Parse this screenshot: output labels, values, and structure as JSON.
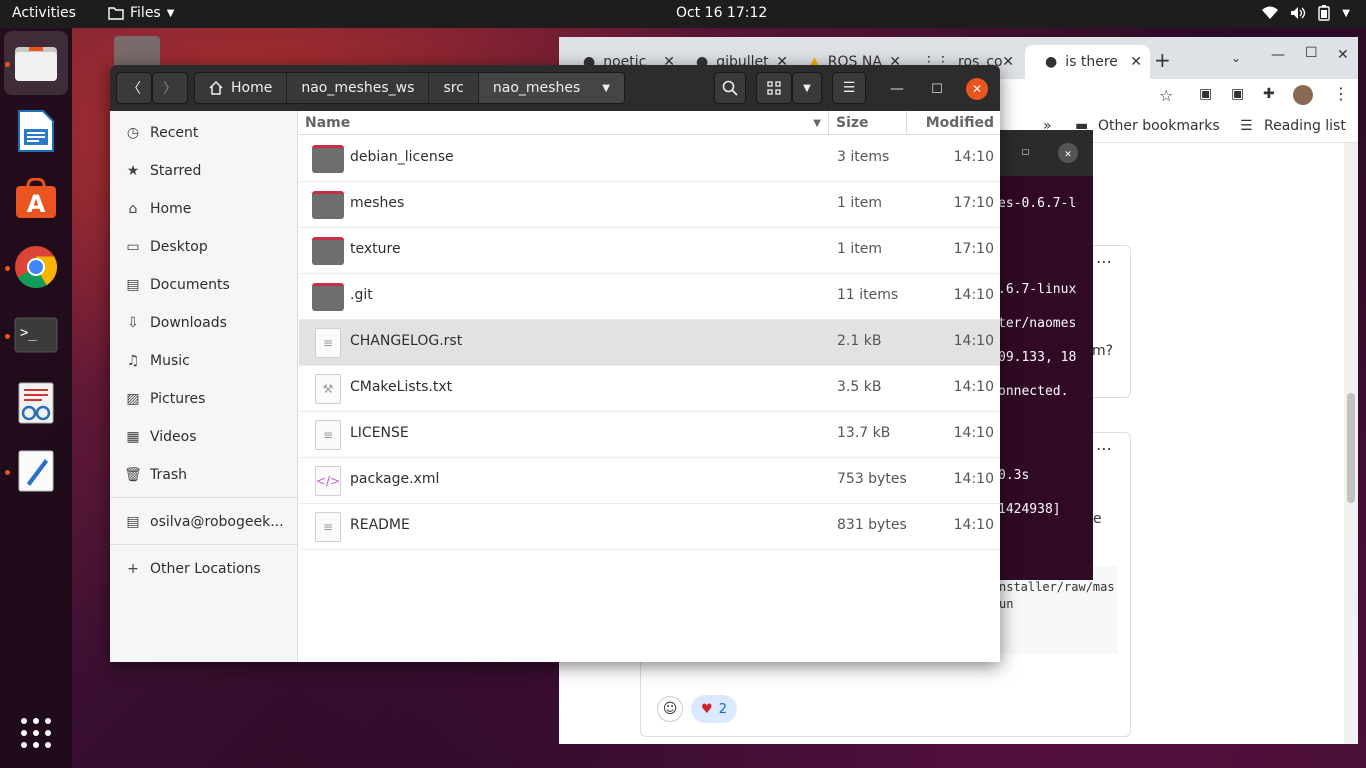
{
  "topbar": {
    "activities": "Activities",
    "app": "Files",
    "clock": "Oct 16  17:12"
  },
  "dock": {
    "apps": [
      "files-icon",
      "writer-icon",
      "software-icon",
      "chrome-icon",
      "terminal-icon",
      "reader-icon",
      "text-editor-icon"
    ],
    "grid_icon": "show-apps-icon"
  },
  "browser": {
    "tabs": [
      {
        "label": "noetic"
      },
      {
        "label": "gibullet"
      },
      {
        "label": "ROS NA"
      },
      {
        "label": "ros_co"
      },
      {
        "label": "is there"
      }
    ],
    "bookmarks": {
      "chevron": "»",
      "other": "Other bookmarks",
      "reading": "Reading list"
    },
    "reaction_count": "2"
  },
  "terminal": {
    "lines": [
      "es-0.6.7-l",
      ".6.7-linux",
      "ter/naomes",
      "09.133, 18",
      "onnected.",
      "0.3s",
      "1424938]"
    ],
    "side_text": [
      "m?",
      "e"
    ],
    "code_lines": [
      "nstaller/raw/mas",
      "un"
    ]
  },
  "files": {
    "breadcrumbs": [
      "Home",
      "nao_meshes_ws",
      "src",
      "nao_meshes"
    ],
    "columns": {
      "name": "Name",
      "size": "Size",
      "modified": "Modified"
    },
    "sidebar": [
      {
        "label": "Recent",
        "icon": "clock-icon"
      },
      {
        "label": "Starred",
        "icon": "star-icon"
      },
      {
        "label": "Home",
        "icon": "home-icon"
      },
      {
        "label": "Desktop",
        "icon": "desktop-icon"
      },
      {
        "label": "Documents",
        "icon": "documents-icon"
      },
      {
        "label": "Downloads",
        "icon": "download-icon"
      },
      {
        "label": "Music",
        "icon": "music-icon"
      },
      {
        "label": "Pictures",
        "icon": "pictures-icon"
      },
      {
        "label": "Videos",
        "icon": "videos-icon"
      },
      {
        "label": "Trash",
        "icon": "trash-icon"
      },
      {
        "label": "osilva@robogeek...",
        "icon": "network-drive-icon"
      },
      {
        "label": "Other Locations",
        "icon": "plus-icon"
      }
    ],
    "rows": [
      {
        "name": "debian_license",
        "size": "3 items",
        "modified": "14:10",
        "type": "folder"
      },
      {
        "name": "meshes",
        "size": "1 item",
        "modified": "17:10",
        "type": "folder"
      },
      {
        "name": "texture",
        "size": "1 item",
        "modified": "17:10",
        "type": "folder"
      },
      {
        "name": ".git",
        "size": "11 items",
        "modified": "14:10",
        "type": "folder"
      },
      {
        "name": "CHANGELOG.rst",
        "size": "2.1 kB",
        "modified": "14:10",
        "type": "text"
      },
      {
        "name": "CMakeLists.txt",
        "size": "3.5 kB",
        "modified": "14:10",
        "type": "build"
      },
      {
        "name": "LICENSE",
        "size": "13.7 kB",
        "modified": "14:10",
        "type": "text"
      },
      {
        "name": "package.xml",
        "size": "753 bytes",
        "modified": "14:10",
        "type": "xml"
      },
      {
        "name": "README",
        "size": "831 bytes",
        "modified": "14:10",
        "type": "text"
      }
    ],
    "selected_row": "CHANGELOG.rst"
  },
  "colors": {
    "accent": "#e95420",
    "close": "#e95420",
    "terminal_bg": "#300a24",
    "selected_row": "#e2e2e2"
  }
}
